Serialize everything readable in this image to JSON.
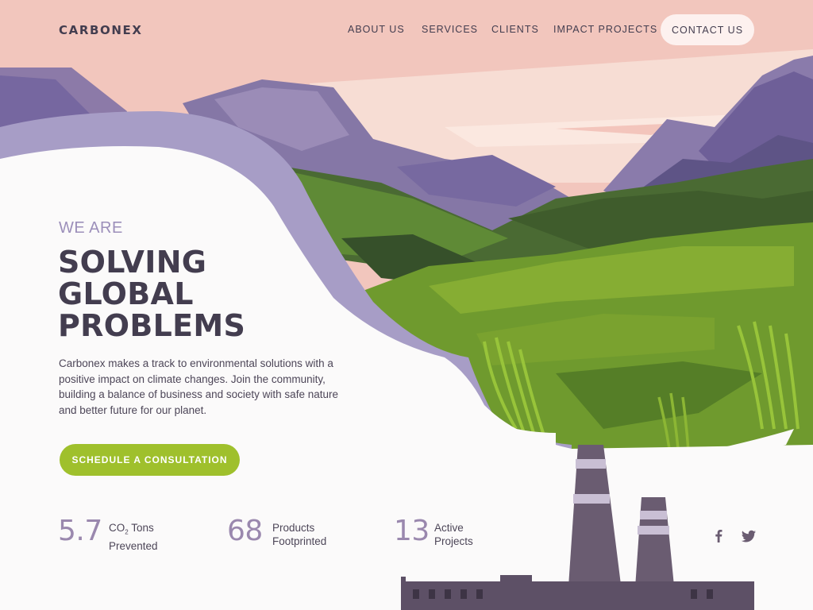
{
  "brand": {
    "name": "CARBONEX"
  },
  "nav": {
    "links": [
      {
        "label": "ABOUT US"
      },
      {
        "label": "SERVICES"
      },
      {
        "label": "CLIENTS"
      },
      {
        "label": "IMPACT PROJECTS"
      }
    ],
    "contact_label": "CONTACT US"
  },
  "hero": {
    "eyebrow": "WE ARE",
    "headline": [
      "SOLVING",
      "GLOBAL",
      "PROBLEMS"
    ],
    "description": "Carbonex makes a track to environmental solutions with a positive impact on climate changes. Join the community, building a balance of business and society with safe nature and better future for our planet.",
    "cta_label": "SCHEDULE A CONSULTATION"
  },
  "stats": [
    {
      "value": "5.7",
      "label_line1_pre": "CO",
      "label_line1_sub": "2",
      "label_line1_post": " Tons",
      "label_line2": "Prevented"
    },
    {
      "value": "68",
      "label_line1": "Products",
      "label_line2": "Footprinted"
    },
    {
      "value": "13",
      "label_line1": "Active",
      "label_line2": "Projects"
    }
  ],
  "social": [
    {
      "icon": "facebook-icon"
    },
    {
      "icon": "twitter-icon"
    }
  ],
  "colors": {
    "sky": "#f2c6bd",
    "accent_green": "#9fc02c",
    "heading": "#433d4f",
    "stat_number": "#9a88ae",
    "eyebrow": "#9c8fba"
  }
}
